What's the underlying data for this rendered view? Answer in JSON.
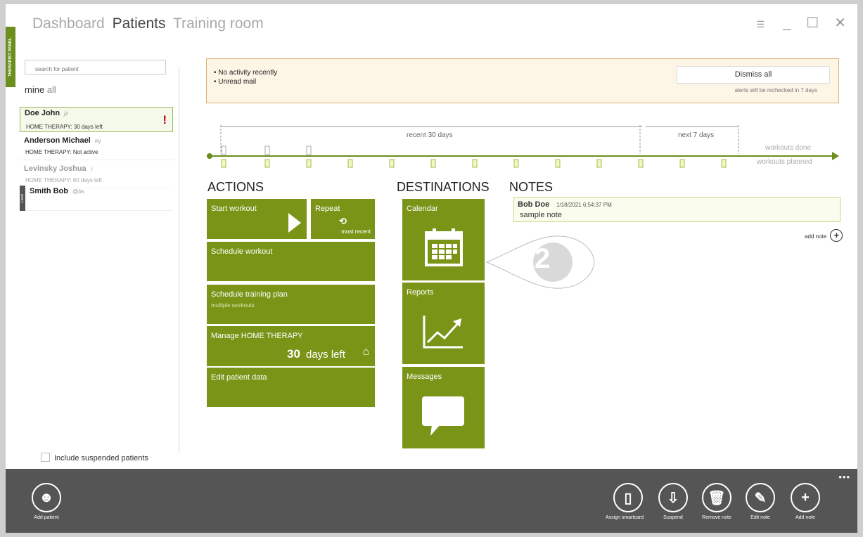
{
  "nav": {
    "dashboard": "Dashboard",
    "patients": "Patients",
    "training": "Training room"
  },
  "therapist_panel": "THERAPIST PANEL",
  "search": {
    "placeholder": "search for patient"
  },
  "filter": {
    "mine": "mine",
    "all": "all"
  },
  "patients": [
    {
      "name": "Doe John",
      "initials": "jz",
      "status": "HOME THERAPY:  30 days left",
      "alert": "!"
    },
    {
      "name": "Anderson Michael",
      "initials": "mj",
      "status": "HOME THERAPY: Not active"
    },
    {
      "name": "Levinsky Joshua",
      "initials": "jl",
      "status": "HOME THERAPY:  60 days left"
    },
    {
      "name": "Smith Bob",
      "initials": "@bs",
      "badge": "Local"
    }
  ],
  "include_suspended": "Include suspended patients",
  "alerts": {
    "items": [
      "• No activity recently",
      "• Unread mail"
    ],
    "dismiss": "Dismiss all",
    "recheck": "alerts will be rechecked in 7 days"
  },
  "timeline": {
    "recent": "recent 30 days",
    "next": "next 7 days",
    "done": "workouts done",
    "planned": "workouts planned",
    "done_count": "1",
    "planned_count": "1"
  },
  "sections": {
    "actions": "ACTIONS",
    "destinations": "DESTINATIONS",
    "notes": "NOTES"
  },
  "actions": {
    "start": "Start workout",
    "repeat": "Repeat",
    "repeat_sub": "most recent",
    "schedule": "Schedule workout",
    "plan": "Schedule training plan",
    "plan_sub": "multiple workouts",
    "manage": "Manage  HOME THERAPY",
    "days": "30",
    "days_left": "days left",
    "edit": "Edit patient data"
  },
  "destinations": {
    "calendar": "Calendar",
    "reports": "Reports",
    "messages": "Messages"
  },
  "note": {
    "author": "Bob Doe",
    "date": "1/18/2021 6:54:37 PM",
    "text": "sample note",
    "add": "add note"
  },
  "callout": "2",
  "bottom": {
    "add_patient": "Add patient",
    "assign": "Assign smartcard",
    "suspend": "Suspend",
    "remove": "Remove note",
    "edit": "Edit note",
    "add": "Add note",
    "more": "•••"
  }
}
